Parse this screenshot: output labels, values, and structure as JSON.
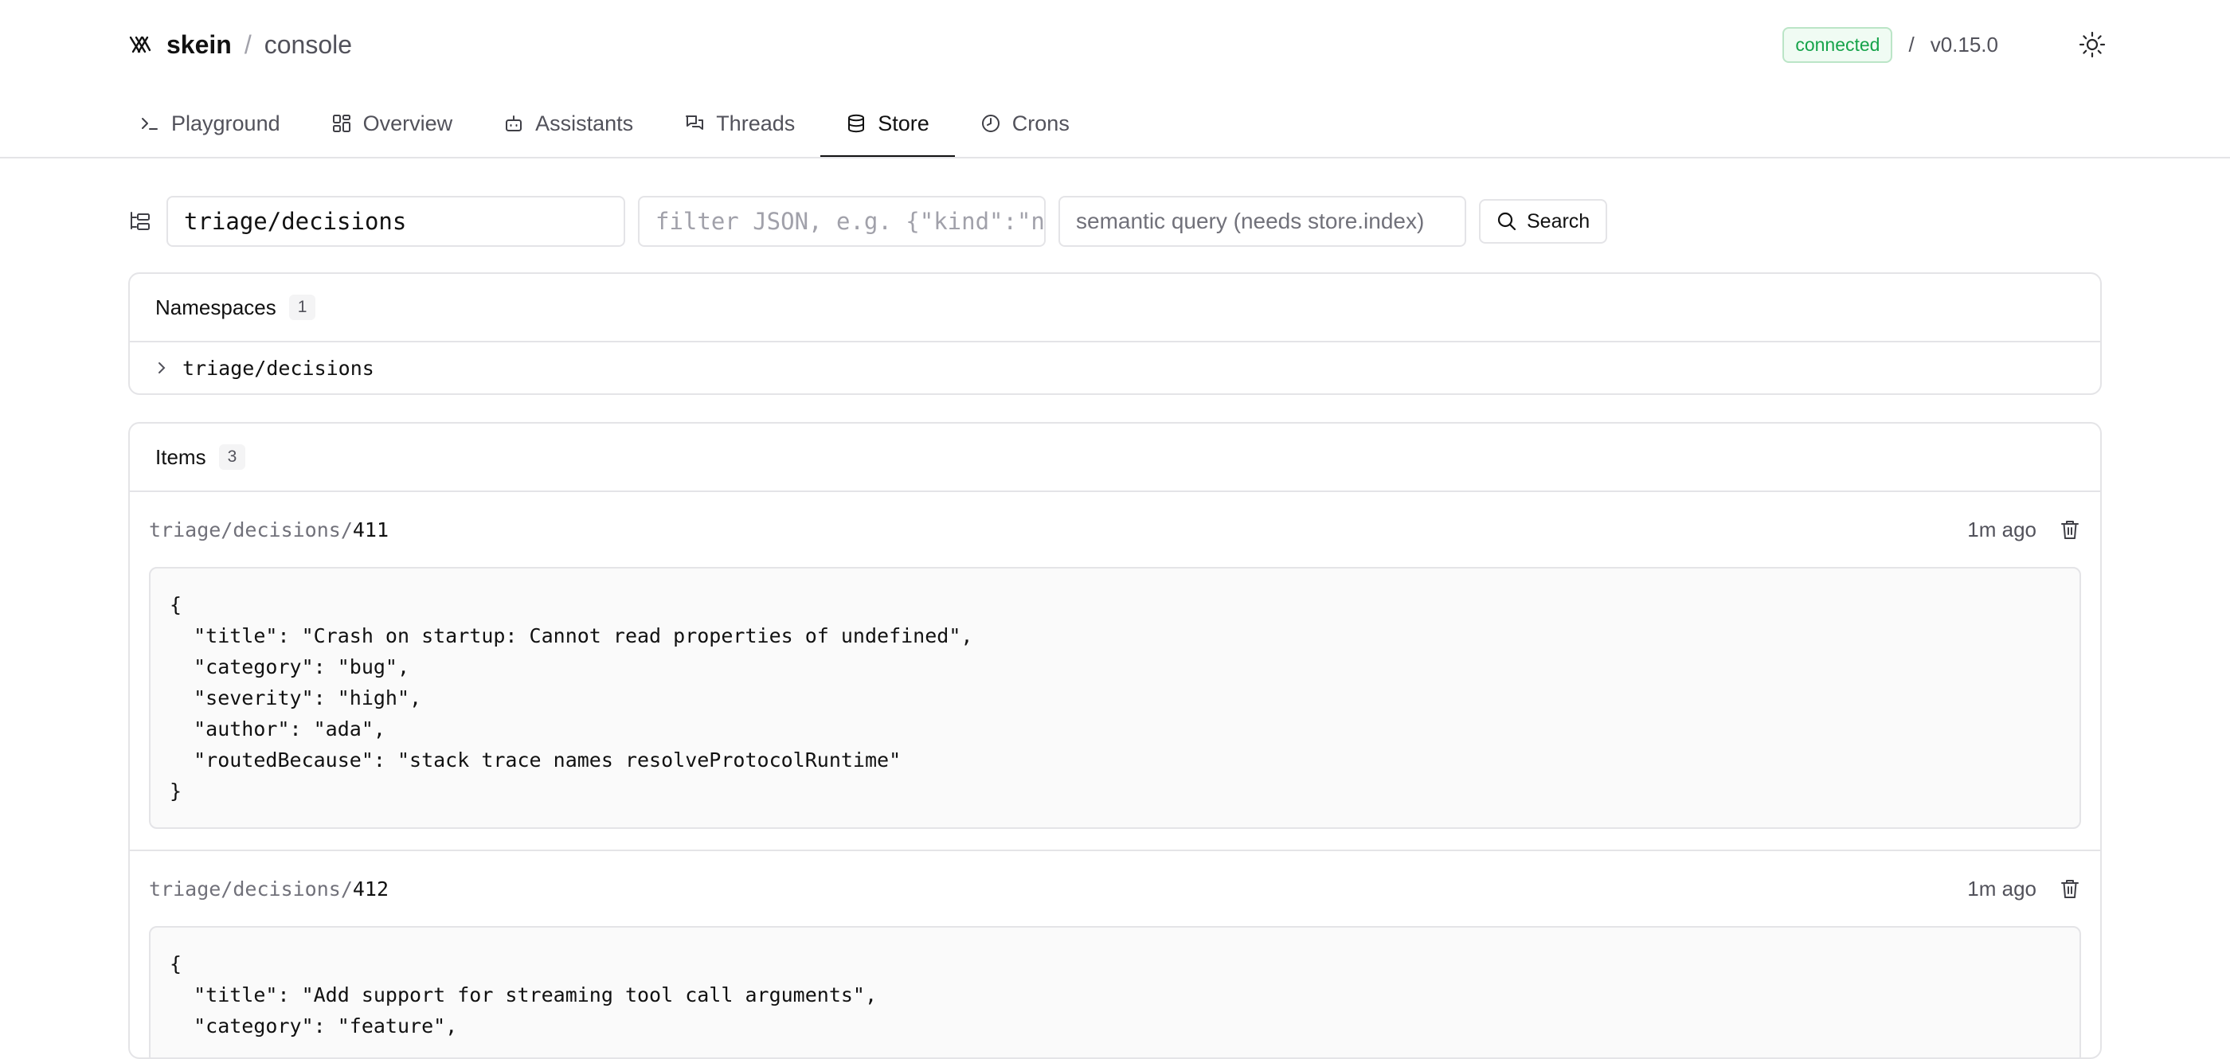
{
  "app": {
    "name": "skein",
    "separator": "/",
    "section": "console"
  },
  "status": {
    "connection": "connected",
    "separator": "/",
    "version": "v0.15.0",
    "accent": "#16a34a"
  },
  "tabs": [
    {
      "label": "Playground",
      "icon": "terminal-icon"
    },
    {
      "label": "Overview",
      "icon": "dashboard-icon"
    },
    {
      "label": "Assistants",
      "icon": "bot-icon"
    },
    {
      "label": "Threads",
      "icon": "chat-icon"
    },
    {
      "label": "Store",
      "icon": "database-icon",
      "active": true
    },
    {
      "label": "Crons",
      "icon": "clock-icon"
    }
  ],
  "search": {
    "namespace_value": "triage/decisions",
    "filter_placeholder": "filter JSON, e.g. {\"kind\":\"note\"}",
    "semantic_placeholder": "semantic query (needs store.index)",
    "button_label": "Search"
  },
  "namespaces": {
    "title": "Namespaces",
    "count": "1",
    "items": [
      "triage/decisions"
    ]
  },
  "items": {
    "title": "Items",
    "count": "3",
    "list": [
      {
        "prefix": "triage/decisions/",
        "id": "411",
        "age": "1m ago",
        "json": "{\n  \"title\": \"Crash on startup: Cannot read properties of undefined\",\n  \"category\": \"bug\",\n  \"severity\": \"high\",\n  \"author\": \"ada\",\n  \"routedBecause\": \"stack trace names resolveProtocolRuntime\"\n}"
      },
      {
        "prefix": "triage/decisions/",
        "id": "412",
        "age": "1m ago",
        "json": "{\n  \"title\": \"Add support for streaming tool call arguments\",\n  \"category\": \"feature\","
      }
    ]
  }
}
